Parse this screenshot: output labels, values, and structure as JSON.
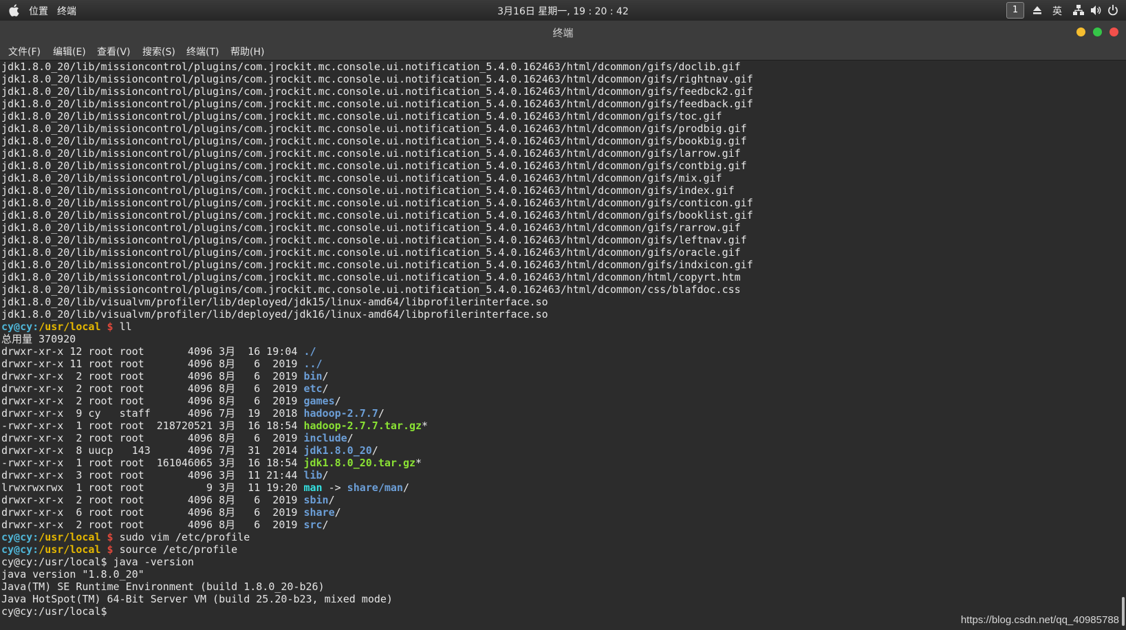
{
  "panel": {
    "menu_places": "位置",
    "menu_terminal": "终端",
    "clock": "3月16日 星期一, 19 : 20 : 42",
    "workspace": "1",
    "input_method": "英",
    "icons": [
      "apple-icon",
      "eject-icon",
      "network-icon",
      "volume-icon",
      "power-icon"
    ]
  },
  "window": {
    "title": "终端",
    "buttons": {
      "minimize": "#f5bd2f",
      "maximize": "#35c648",
      "close": "#f2504b"
    }
  },
  "menubar": {
    "items": [
      "文件(F)",
      "编辑(E)",
      "查看(V)",
      "搜索(S)",
      "终端(T)",
      "帮助(H)"
    ]
  },
  "terminal": {
    "path_prefix": "jdk1.8.0_20/lib/missioncontrol/plugins/com.jrockit.mc.console.ui.notification_5.4.0.162463/html/dcommon/",
    "path_lines": [
      "gifs/doclib.gif",
      "gifs/rightnav.gif",
      "gifs/feedbck2.gif",
      "gifs/feedback.gif",
      "gifs/toc.gif",
      "gifs/prodbig.gif",
      "gifs/bookbig.gif",
      "gifs/larrow.gif",
      "gifs/contbig.gif",
      "gifs/mix.gif",
      "gifs/index.gif",
      "gifs/conticon.gif",
      "gifs/booklist.gif",
      "gifs/rarrow.gif",
      "gifs/leftnav.gif",
      "gifs/oracle.gif",
      "gifs/indxicon.gif",
      "html/copyrt.htm",
      "css/blafdoc.css"
    ],
    "visualvm_lines": [
      "jdk1.8.0_20/lib/visualvm/profiler/lib/deployed/jdk15/linux-amd64/libprofilerinterface.so",
      "jdk1.8.0_20/lib/visualvm/profiler/lib/deployed/jdk16/linux-amd64/libprofilerinterface.so"
    ],
    "prompt": {
      "user": "cy@cy",
      "colon": ":",
      "path": "/usr/local",
      "dollar": "$"
    },
    "cmd_ll": "ll",
    "total": "总用量 370920",
    "listing": [
      {
        "meta": "drwxr-xr-x 12 root root       4096 3月  16 19:04 ",
        "name": "./",
        "kind": "dir",
        "suffix": ""
      },
      {
        "meta": "drwxr-xr-x 11 root root       4096 8月   6  2019 ",
        "name": "../",
        "kind": "dir",
        "suffix": ""
      },
      {
        "meta": "drwxr-xr-x  2 root root       4096 8月   6  2019 ",
        "name": "bin",
        "kind": "dir",
        "suffix": "/"
      },
      {
        "meta": "drwxr-xr-x  2 root root       4096 8月   6  2019 ",
        "name": "etc",
        "kind": "dir",
        "suffix": "/"
      },
      {
        "meta": "drwxr-xr-x  2 root root       4096 8月   6  2019 ",
        "name": "games",
        "kind": "dir",
        "suffix": "/"
      },
      {
        "meta": "drwxr-xr-x  9 cy   staff      4096 7月  19  2018 ",
        "name": "hadoop-2.7.7",
        "kind": "dir",
        "suffix": "/"
      },
      {
        "meta": "-rwxr-xr-x  1 root root  218720521 3月  16 18:54 ",
        "name": "hadoop-2.7.7.tar.gz",
        "kind": "exe",
        "suffix": "*"
      },
      {
        "meta": "drwxr-xr-x  2 root root       4096 8月   6  2019 ",
        "name": "include",
        "kind": "dir",
        "suffix": "/"
      },
      {
        "meta": "drwxr-xr-x  8 uucp   143      4096 7月  31  2014 ",
        "name": "jdk1.8.0_20",
        "kind": "dir",
        "suffix": "/"
      },
      {
        "meta": "-rwxr-xr-x  1 root root  161046065 3月  16 18:54 ",
        "name": "jdk1.8.0_20.tar.gz",
        "kind": "exe",
        "suffix": "*"
      },
      {
        "meta": "drwxr-xr-x  3 root root       4096 3月  11 21:44 ",
        "name": "lib",
        "kind": "dir",
        "suffix": "/"
      },
      {
        "meta": "lrwxrwxrwx  1 root root          9 3月  11 19:20 ",
        "name": "man",
        "kind": "lnk",
        "suffix": " -> ",
        "target": "share/man",
        "target_suffix": "/"
      },
      {
        "meta": "drwxr-xr-x  2 root root       4096 8月   6  2019 ",
        "name": "sbin",
        "kind": "dir",
        "suffix": "/"
      },
      {
        "meta": "drwxr-xr-x  6 root root       4096 8月   6  2019 ",
        "name": "share",
        "kind": "dir",
        "suffix": "/"
      },
      {
        "meta": "drwxr-xr-x  2 root root       4096 8月   6  2019 ",
        "name": "src",
        "kind": "dir",
        "suffix": "/"
      }
    ],
    "cmd_vim": "sudo vim /etc/profile",
    "cmd_source": "source /etc/profile",
    "plain_prompt": "cy@cy:/usr/local$",
    "cmd_java": "java -version",
    "java_out": [
      "java version \"1.8.0_20\"",
      "Java(TM) SE Runtime Environment (build 1.8.0_20-b26)",
      "Java HotSpot(TM) 64-Bit Server VM (build 25.20-b23, mixed mode)"
    ]
  },
  "watermark": "https://blog.csdn.net/qq_40985788"
}
